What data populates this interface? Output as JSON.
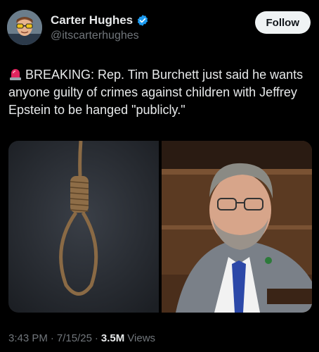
{
  "author": {
    "name": "Carter Hughes",
    "handle": "@itscarterhughes",
    "verified_icon": "verified-badge-icon",
    "verified_color": "#1d9bf0"
  },
  "follow_label": "Follow",
  "tweet": {
    "emoji_icon": "siren-icon",
    "text": "BREAKING: Rep. Tim Burchett just said he wants anyone guilty of crimes against children with Jeffrey Epstein to be hanged \"publicly.\""
  },
  "media": {
    "left_image": "noose-photo",
    "right_image": "congressman-photo"
  },
  "meta": {
    "time": "3:43 PM",
    "sep1": "·",
    "date": "7/15/25",
    "sep2": "·",
    "views_count": "3.5M",
    "views_label": "Views"
  }
}
